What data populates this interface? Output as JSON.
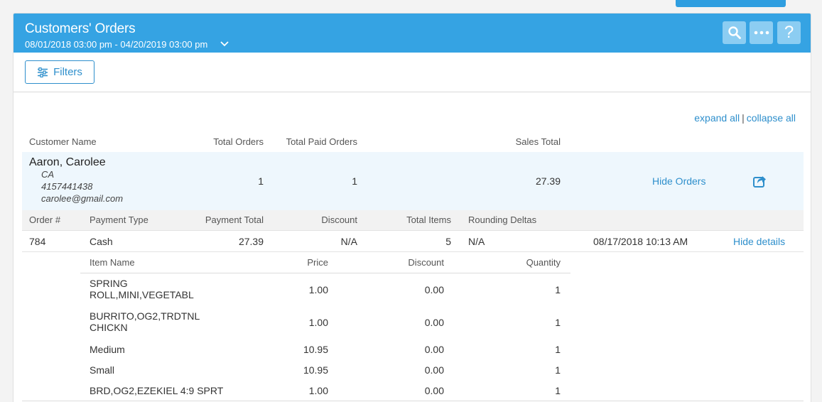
{
  "header": {
    "title": "Customers' Orders",
    "date_range": "08/01/2018 03:00 pm - 04/20/2019 03:00 pm"
  },
  "toolbar": {
    "filters_label": "Filters"
  },
  "expand": {
    "expand_all": "expand all",
    "separator": "|",
    "collapse_all": "collapse all"
  },
  "customer_table": {
    "columns": [
      "Customer Name",
      "Total Orders",
      "Total Paid Orders",
      "Sales Total"
    ]
  },
  "customer": {
    "name": "Aaron, Carolee",
    "state": "CA",
    "phone": "4157441438",
    "email": "carolee@gmail.com",
    "total_orders": "1",
    "total_paid_orders": "1",
    "sales_total": "27.39",
    "hide_orders_label": "Hide Orders"
  },
  "order_table": {
    "columns": [
      "Order #",
      "Payment Type",
      "Payment Total",
      "Discount",
      "Total Items",
      "Rounding Deltas"
    ]
  },
  "order": {
    "number": "784",
    "payment_type": "Cash",
    "payment_total": "27.39",
    "discount": "N/A",
    "total_items": "5",
    "rounding_deltas": "N/A",
    "datetime": "08/17/2018 10:13 AM",
    "hide_details_label": "Hide details"
  },
  "item_table": {
    "columns": [
      "Item Name",
      "Price",
      "Discount",
      "Quantity"
    ],
    "rows": [
      {
        "name": "SPRING ROLL,MINI,VEGETABL",
        "price": "1.00",
        "discount": "0.00",
        "quantity": "1"
      },
      {
        "name": "BURRITO,OG2,TRDTNL CHICKN",
        "price": "1.00",
        "discount": "0.00",
        "quantity": "1"
      },
      {
        "name": "Medium",
        "price": "10.95",
        "discount": "0.00",
        "quantity": "1"
      },
      {
        "name": "Small",
        "price": "10.95",
        "discount": "0.00",
        "quantity": "1"
      },
      {
        "name": "BRD,OG2,EZEKIEL 4:9 SPRT",
        "price": "1.00",
        "discount": "0.00",
        "quantity": "1"
      }
    ]
  },
  "colors": {
    "header": "#35a3e3",
    "accent": "#2e8fcc",
    "customer_row": "#eef7fd"
  },
  "icons": [
    "search-icon",
    "more-icon",
    "help-icon",
    "chevron-down-icon",
    "filters-icon",
    "share-icon"
  ]
}
